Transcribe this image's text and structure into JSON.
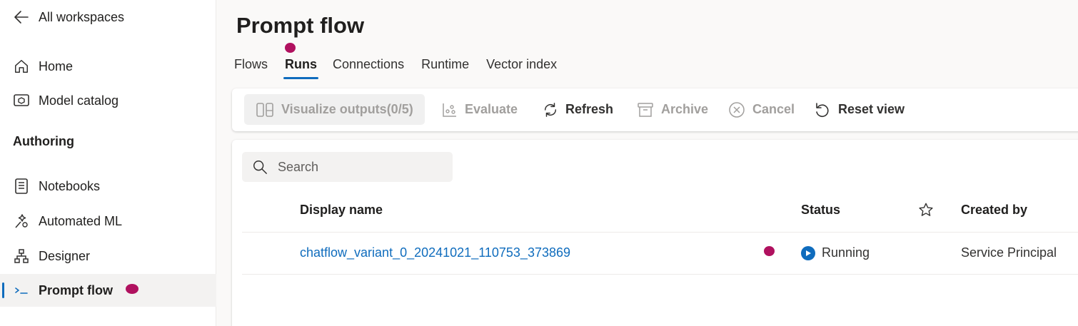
{
  "sidebar": {
    "back_label": "All workspaces",
    "items": [
      {
        "label": "Home",
        "icon": "home-icon"
      },
      {
        "label": "Model catalog",
        "icon": "model-catalog-icon"
      }
    ],
    "section_title": "Authoring",
    "authoring_items": [
      {
        "label": "Notebooks",
        "icon": "notebook-icon"
      },
      {
        "label": "Automated ML",
        "icon": "automated-ml-icon"
      },
      {
        "label": "Designer",
        "icon": "designer-icon"
      },
      {
        "label": "Prompt flow",
        "icon": "prompt-flow-icon",
        "active": true
      }
    ]
  },
  "page": {
    "title": "Prompt flow",
    "tabs": [
      {
        "label": "Flows"
      },
      {
        "label": "Runs",
        "active": true
      },
      {
        "label": "Connections"
      },
      {
        "label": "Runtime"
      },
      {
        "label": "Vector index"
      }
    ]
  },
  "toolbar": {
    "visualize_label": "Visualize outputs(0/5)",
    "evaluate_label": "Evaluate",
    "refresh_label": "Refresh",
    "archive_label": "Archive",
    "cancel_label": "Cancel",
    "reset_label": "Reset view"
  },
  "table": {
    "search_placeholder": "Search",
    "columns": {
      "display_name": "Display name",
      "status": "Status",
      "created_by": "Created by"
    },
    "rows": [
      {
        "display_name": "chatflow_variant_0_20241021_110753_373869",
        "status": "Running",
        "created_by": "Service Principal"
      }
    ]
  },
  "colors": {
    "accent": "#0f6cbd",
    "marker": "#b0115f"
  }
}
